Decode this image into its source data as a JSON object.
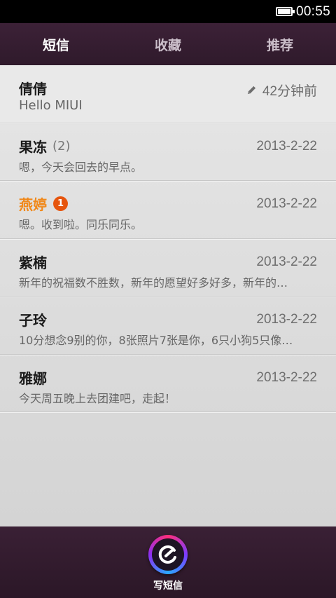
{
  "status_bar": {
    "time": "00:55",
    "battery_icon": "battery-full-icon"
  },
  "tabs": [
    {
      "label": "短信",
      "active": true
    },
    {
      "label": "收藏",
      "active": false
    },
    {
      "label": "推荐",
      "active": false
    }
  ],
  "conversations": [
    {
      "name": "倩倩",
      "count": "",
      "badge": "",
      "time": "42分钟前",
      "draft": true,
      "preview": "Hello MIUI",
      "unread": false
    },
    {
      "name": "果冻",
      "count": "(2)",
      "badge": "",
      "time": "2013-2-22",
      "draft": false,
      "preview": "嗯，今天会回去的早点。",
      "unread": false
    },
    {
      "name": "燕婷",
      "count": "",
      "badge": "1",
      "time": "2013-2-22",
      "draft": false,
      "preview": "嗯。收到啦。同乐同乐。",
      "unread": true
    },
    {
      "name": "紫楠",
      "count": "",
      "badge": "",
      "time": "2013-2-22",
      "draft": false,
      "preview": "新年的祝福数不胜数，新年的愿望好多好多，新年的…",
      "unread": false
    },
    {
      "name": "子玲",
      "count": "",
      "badge": "",
      "time": "2013-2-22",
      "draft": false,
      "preview": "10分想念9别的你，8张照片7张是你，6只小狗5只像…",
      "unread": false
    },
    {
      "name": "雅娜",
      "count": "",
      "badge": "",
      "time": "2013-2-22",
      "draft": false,
      "preview": "今天周五晚上去团建吧，走起！",
      "unread": false
    }
  ],
  "bottom_bar": {
    "compose_label": "写短信",
    "compose_icon": "compose-message-icon"
  },
  "colors": {
    "accent_unread": "#f0891b",
    "badge": "#e6550e",
    "bar": "#3a2035"
  }
}
